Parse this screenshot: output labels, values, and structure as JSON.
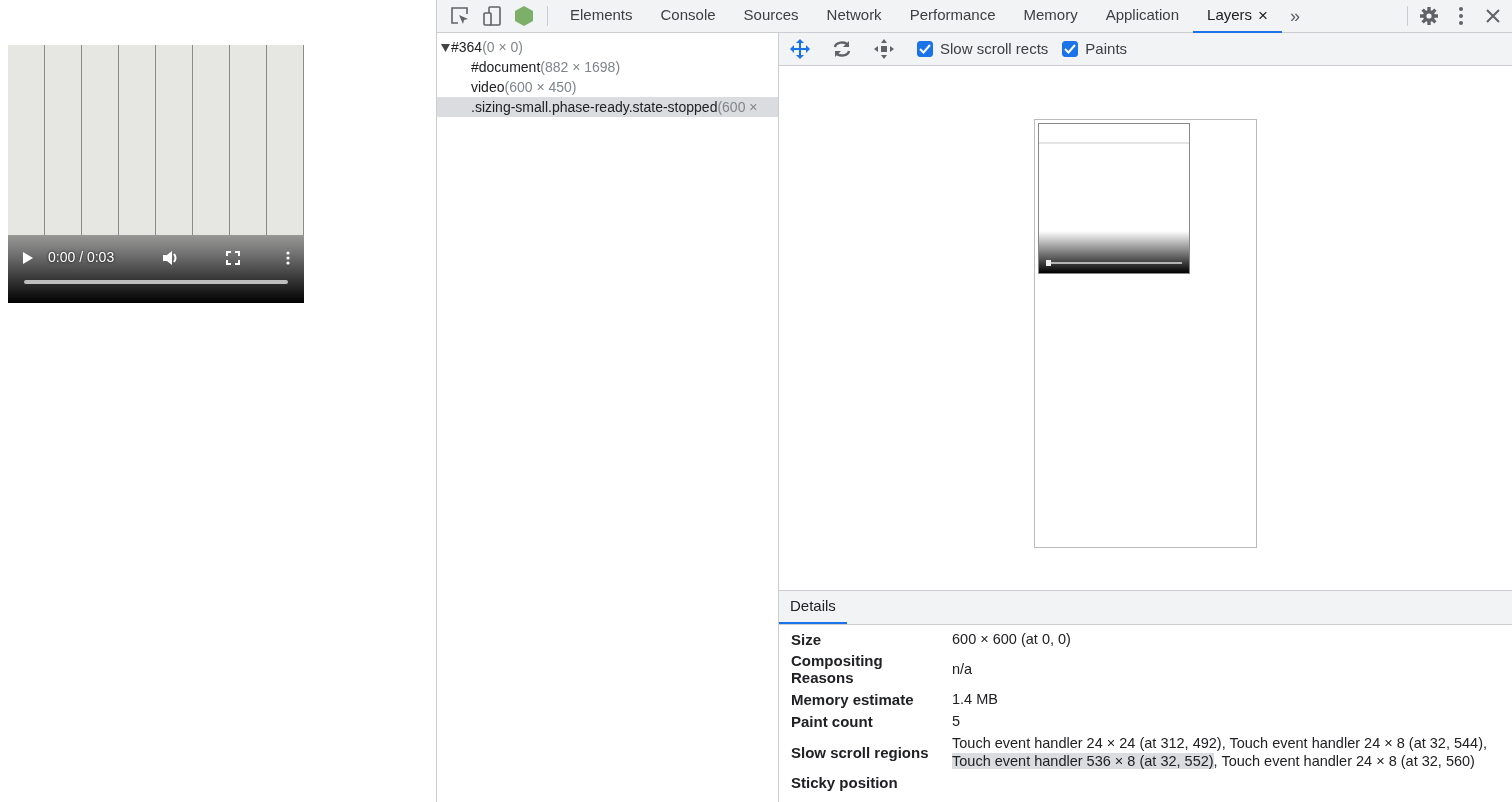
{
  "video_player": {
    "time": "0:00 / 0:03",
    "progress": {
      "level": 0
    }
  },
  "devtools": {
    "tabs": [
      {
        "label": "Elements",
        "selected": false,
        "closable": false
      },
      {
        "label": "Console",
        "selected": false,
        "closable": false
      },
      {
        "label": "Sources",
        "selected": false,
        "closable": false
      },
      {
        "label": "Network",
        "selected": false,
        "closable": false
      },
      {
        "label": "Performance",
        "selected": false,
        "closable": false
      },
      {
        "label": "Memory",
        "selected": false,
        "closable": false
      },
      {
        "label": "Application",
        "selected": false,
        "closable": false
      },
      {
        "label": "Layers",
        "selected": true,
        "closable": true
      }
    ],
    "close_tab_glyph": "×",
    "more_tabs_glyph": "»",
    "layer_tree": [
      {
        "name": "#364",
        "size": "(0 × 0)",
        "expanded": true,
        "selected": false,
        "children": [
          {
            "name": "#document",
            "size": "(882 × 1698)",
            "selected": false
          },
          {
            "name": "video",
            "size": "(600 × 450)",
            "selected": false
          },
          {
            "name": ".sizing-small.phase-ready.state-stopped",
            "size": "(600 ×",
            "selected": true
          }
        ]
      }
    ],
    "layers_toolbar": {
      "checkboxes": [
        {
          "label": "Slow scroll rects",
          "checked": true
        },
        {
          "label": "Paints",
          "checked": true
        }
      ]
    },
    "details": {
      "tab": "Details",
      "rows": [
        {
          "label": "Size",
          "value": [
            {
              "text": "600 × 600 (at 0, 0)",
              "highlighted": false
            }
          ]
        },
        {
          "label": "Compositing Reasons",
          "value": [
            {
              "text": "n/a",
              "highlighted": false
            }
          ]
        },
        {
          "label": "Memory estimate",
          "value": [
            {
              "text": "1.4 MB",
              "highlighted": false
            }
          ]
        },
        {
          "label": "Paint count",
          "value": [
            {
              "text": "5",
              "highlighted": false
            }
          ]
        },
        {
          "label": "Slow scroll regions",
          "value": [
            {
              "text": "Touch event handler 24 × 24 (at 312, 492), Touch event handler 24 × 8 (at 32, 544), ",
              "highlighted": false
            },
            {
              "text": "Touch event handler 536 × 8 (at 32, 552)",
              "highlighted": true
            },
            {
              "text": ", Touch event handler 24 × 8 (at 32, 560)",
              "highlighted": false
            }
          ]
        },
        {
          "label": "Sticky position",
          "value": []
        }
      ]
    }
  }
}
